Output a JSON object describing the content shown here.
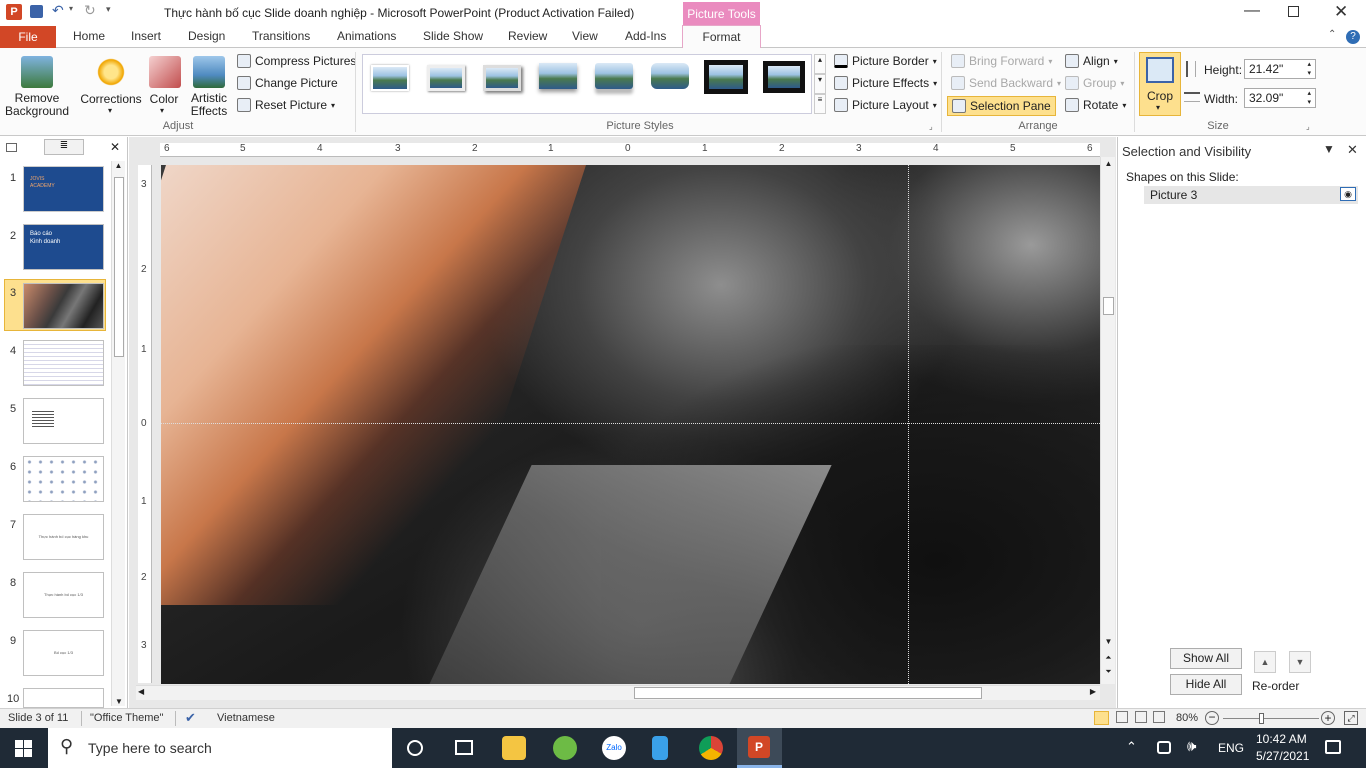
{
  "window": {
    "title": "Thực hành bố cục Slide doanh nghiệp  -  Microsoft PowerPoint (Product Activation Failed)",
    "context_tab_group": "Picture Tools",
    "colors": {
      "file_tab": "#d24726",
      "accent": "#c13584",
      "context_bg": "#ea8bbf",
      "ribbon_bg": "#fbfbfb"
    }
  },
  "tabs": [
    "File",
    "Home",
    "Insert",
    "Design",
    "Transitions",
    "Animations",
    "Slide Show",
    "Review",
    "View",
    "Add-Ins",
    "Format"
  ],
  "ribbon": {
    "adjust": {
      "label": "Adjust",
      "remove_background": "Remove Background",
      "corrections": "Corrections",
      "color": "Color",
      "artistic_effects": "Artistic Effects",
      "compress": "Compress Pictures",
      "change": "Change Picture",
      "reset": "Reset Picture"
    },
    "styles": {
      "label": "Picture Styles",
      "border": "Picture Border",
      "effects": "Picture Effects",
      "layout": "Picture Layout"
    },
    "arrange": {
      "label": "Arrange",
      "bring_forward": "Bring Forward",
      "send_backward": "Send Backward",
      "selection_pane": "Selection Pane",
      "align": "Align",
      "group": "Group",
      "rotate": "Rotate"
    },
    "size": {
      "label": "Size",
      "crop": "Crop",
      "height_label": "Height:",
      "height_value": "21.42\"",
      "width_label": "Width:",
      "width_value": "32.09\""
    }
  },
  "slides": [
    {
      "num": "1",
      "lines": [
        "JOVIS",
        "ACADEMY"
      ]
    },
    {
      "num": "2",
      "lines": [
        "Báo  cáo",
        "Kinh  doanh"
      ]
    },
    {
      "num": "3",
      "lines": []
    },
    {
      "num": "4",
      "lines": []
    },
    {
      "num": "5",
      "lines": []
    },
    {
      "num": "6",
      "lines": []
    },
    {
      "num": "7",
      "lines": [
        "Thực hành bố cục hàng khu"
      ]
    },
    {
      "num": "8",
      "lines": [
        "Thực hành bố cục 1/3"
      ]
    },
    {
      "num": "9",
      "lines": [
        "Bố cục 1/3"
      ]
    },
    {
      "num": "10",
      "lines": []
    }
  ],
  "ruler": {
    "h_ticks": [
      "6",
      "5",
      "4",
      "3",
      "2",
      "1",
      "0",
      "1",
      "2",
      "3",
      "4",
      "5",
      "6"
    ],
    "v_ticks": [
      "3",
      "2",
      "1",
      "0",
      "1",
      "2",
      "3"
    ]
  },
  "selection_pane": {
    "title": "Selection and Visibility",
    "shapes_label": "Shapes on this Slide:",
    "items": [
      "Picture 3"
    ],
    "show_all": "Show All",
    "hide_all": "Hide All",
    "reorder": "Re-order"
  },
  "status": {
    "slide": "Slide 3 of 11",
    "theme": "\"Office Theme\"",
    "language": "Vietnamese",
    "zoom": "80%"
  },
  "taskbar": {
    "search_placeholder": "Type here to search",
    "lang": "ENG",
    "time": "10:42 AM",
    "date": "5/27/2021"
  }
}
